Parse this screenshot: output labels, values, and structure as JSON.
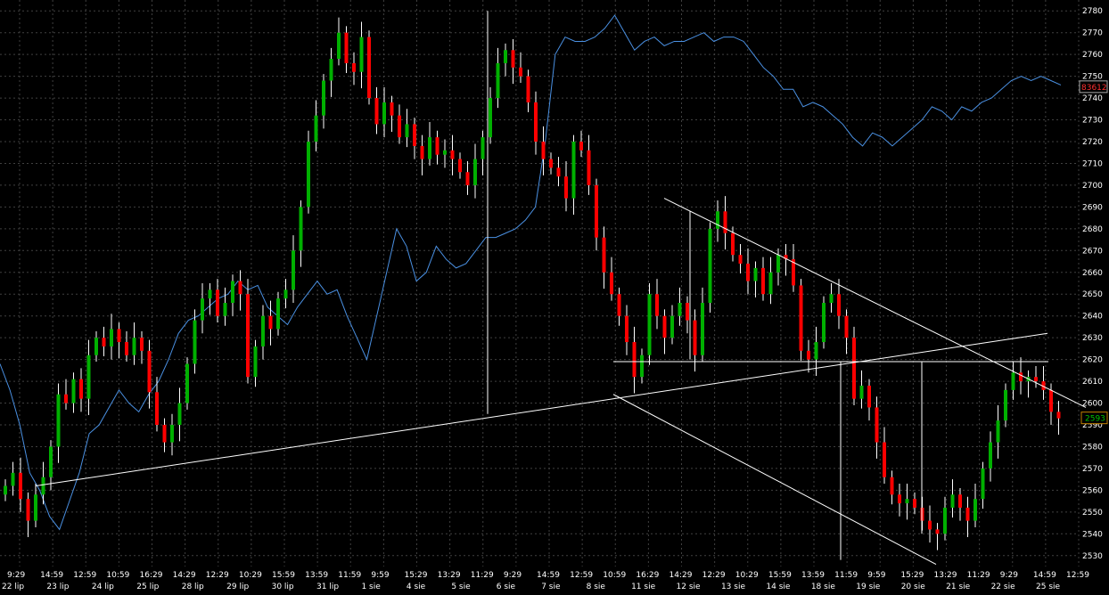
{
  "chart_data": {
    "type": "candlestick",
    "y_axis": {
      "min": 2525,
      "max": 2785,
      "ticks": [
        2530,
        2540,
        2550,
        2560,
        2570,
        2580,
        2590,
        2600,
        2610,
        2620,
        2630,
        2640,
        2650,
        2660,
        2670,
        2680,
        2690,
        2700,
        2710,
        2720,
        2730,
        2740,
        2750,
        2760,
        2770,
        2780
      ]
    },
    "grid": true,
    "time_labels": [
      "9:29",
      "14:59",
      "12:59",
      "10:59",
      "16:29",
      "14:29",
      "12:29",
      "10:29",
      "15:59",
      "13:59",
      "11:59",
      "9:59",
      "15:29",
      "13:29",
      "11:29",
      "9:29",
      "14:59",
      "12:59",
      "10:59",
      "16:29",
      "14:29",
      "12:29",
      "10:29",
      "15:59",
      "13:59",
      "11:59",
      "9:59",
      "15:29",
      "13:29",
      "11:29",
      "9:29",
      "14:59",
      "12:59"
    ],
    "date_labels": [
      "22 lip",
      "23 lip",
      "24 lip",
      "25 lip",
      "28 lip",
      "29 lip",
      "30 lip",
      "31 lip",
      "1 sie",
      "4 sie",
      "5 sie",
      "6 sie",
      "7 sie",
      "8 sie",
      "11 sie",
      "12 sie",
      "13 sie",
      "14 sie",
      "18 sie",
      "19 sie",
      "20 sie",
      "21 sie",
      "22 sie",
      "25 sie"
    ],
    "last_price_label": "2593",
    "secondary_label": "83612",
    "colors": {
      "up": "#00b000",
      "down": "#ff0000",
      "overlay_line": "#4a90e2",
      "trendline": "#ffffff",
      "grid": "#404040",
      "background": "#000000"
    },
    "price_closes": [
      2562,
      2568,
      2556,
      2546,
      2558,
      2566,
      2580,
      2604,
      2600,
      2611,
      2602,
      2622,
      2630,
      2626,
      2634,
      2628,
      2622,
      2630,
      2624,
      2605,
      2590,
      2582,
      2590,
      2600,
      2618,
      2638,
      2648,
      2652,
      2640,
      2646,
      2656,
      2650,
      2612,
      2626,
      2640,
      2634,
      2648,
      2652,
      2670,
      2690,
      2720,
      2732,
      2748,
      2758,
      2770,
      2756,
      2752,
      2768,
      2740,
      2728,
      2738,
      2732,
      2722,
      2728,
      2718,
      2712,
      2722,
      2714,
      2716,
      2712,
      2706,
      2700,
      2712,
      2722,
      2740,
      2756,
      2762,
      2754,
      2750,
      2738,
      2720,
      2712,
      2708,
      2704,
      2694,
      2720,
      2716,
      2700,
      2676,
      2660,
      2650,
      2640,
      2628,
      2612,
      2622,
      2650,
      2640,
      2630,
      2640,
      2646,
      2638,
      2622,
      2646,
      2680,
      2688,
      2678,
      2668,
      2664,
      2656,
      2662,
      2650,
      2660,
      2668,
      2666,
      2654,
      2624,
      2620,
      2628,
      2646,
      2650,
      2640,
      2630,
      2602,
      2608,
      2598,
      2582,
      2566,
      2558,
      2554,
      2556,
      2552,
      2546,
      2542,
      2540,
      2552,
      2558,
      2552,
      2546,
      2556,
      2570,
      2582,
      2592,
      2606,
      2614,
      2610,
      2612,
      2610,
      2606,
      2596,
      2593
    ],
    "blue_line": [
      2618,
      2606,
      2590,
      2568,
      2560,
      2548,
      2542,
      2555,
      2568,
      2586,
      2590,
      2598,
      2606,
      2600,
      2596,
      2604,
      2610,
      2620,
      2632,
      2638,
      2640,
      2644,
      2648,
      2650,
      2656,
      2652,
      2654,
      2644,
      2640,
      2636,
      2644,
      2650,
      2656,
      2650,
      2652,
      2640,
      2630,
      2620,
      2640,
      2660,
      2680,
      2672,
      2656,
      2660,
      2672,
      2666,
      2662,
      2664,
      2670,
      2676,
      2676,
      2678,
      2680,
      2684,
      2690,
      2720,
      2760,
      2768,
      2766,
      2766,
      2768,
      2772,
      2778,
      2770,
      2762,
      2766,
      2768,
      2764,
      2766,
      2766,
      2768,
      2770,
      2766,
      2768,
      2768,
      2766,
      2760,
      2754,
      2750,
      2744,
      2744,
      2736,
      2738,
      2736,
      2732,
      2728,
      2722,
      2718,
      2724,
      2722,
      2718,
      2722,
      2726,
      2730,
      2736,
      2734,
      2730,
      2736,
      2734,
      2738,
      2740,
      2744,
      2748,
      2750,
      2748,
      2750,
      2748,
      2746
    ],
    "trendlines": [
      {
        "from": [
          0,
          2562
        ],
        "to": [
          1,
          2612
        ]
      },
      {
        "from": [
          0,
          2598
        ],
        "to": [
          1,
          2626
        ]
      },
      {
        "from": [
          0,
          2606
        ],
        "to": [
          1,
          2602
        ]
      },
      {
        "from": [
          0,
          2694
        ],
        "to": [
          1,
          2604
        ]
      },
      {
        "from": [
          0,
          2604
        ],
        "to": [
          1,
          2536
        ]
      }
    ]
  }
}
